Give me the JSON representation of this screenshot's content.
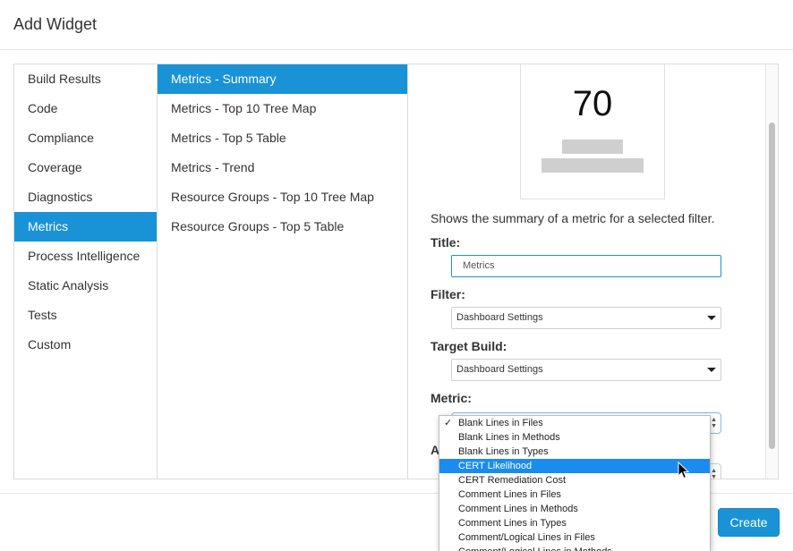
{
  "dialog": {
    "title": "Add Widget"
  },
  "categories": [
    {
      "label": "Build Results",
      "active": false
    },
    {
      "label": "Code",
      "active": false
    },
    {
      "label": "Compliance",
      "active": false
    },
    {
      "label": "Coverage",
      "active": false
    },
    {
      "label": "Diagnostics",
      "active": false
    },
    {
      "label": "Metrics",
      "active": true
    },
    {
      "label": "Process Intelligence",
      "active": false
    },
    {
      "label": "Static Analysis",
      "active": false
    },
    {
      "label": "Tests",
      "active": false
    },
    {
      "label": "Custom",
      "active": false
    }
  ],
  "widgets": [
    {
      "label": "Metrics - Summary",
      "active": true
    },
    {
      "label": "Metrics - Top 10 Tree Map",
      "active": false
    },
    {
      "label": "Metrics - Top 5 Table",
      "active": false
    },
    {
      "label": "Metrics - Trend",
      "active": false
    },
    {
      "label": "Resource Groups - Top 10 Tree Map",
      "active": false
    },
    {
      "label": "Resource Groups - Top 5 Table",
      "active": false
    }
  ],
  "detail": {
    "preview_value": "70",
    "description": "Shows the summary of a metric for a selected filter.",
    "title_label": "Title:",
    "title_value": "Metrics",
    "filter_label": "Filter:",
    "filter_value": "Dashboard Settings",
    "target_build_label": "Target Build:",
    "target_build_value": "Dashboard Settings",
    "metric_label": "Metric:",
    "partial_label": "A"
  },
  "metric_dropdown": {
    "check_mark": "✓",
    "items": [
      {
        "label": "Blank Lines in Files",
        "selected": true,
        "highlighted": false
      },
      {
        "label": "Blank Lines in Methods",
        "selected": false,
        "highlighted": false
      },
      {
        "label": "Blank Lines in Types",
        "selected": false,
        "highlighted": false
      },
      {
        "label": "CERT Likelihood",
        "selected": false,
        "highlighted": true
      },
      {
        "label": "CERT Remediation Cost",
        "selected": false,
        "highlighted": false
      },
      {
        "label": "Comment Lines in Files",
        "selected": false,
        "highlighted": false
      },
      {
        "label": "Comment Lines in Methods",
        "selected": false,
        "highlighted": false
      },
      {
        "label": "Comment Lines in Types",
        "selected": false,
        "highlighted": false
      },
      {
        "label": "Comment/Logical Lines in Files",
        "selected": false,
        "highlighted": false
      },
      {
        "label": "Comment/Logical Lines in Methods",
        "selected": false,
        "highlighted": false
      }
    ]
  },
  "footer": {
    "create_label": "Create"
  },
  "colors": {
    "accent": "#1a93d6",
    "highlight": "#1a8cf0"
  }
}
